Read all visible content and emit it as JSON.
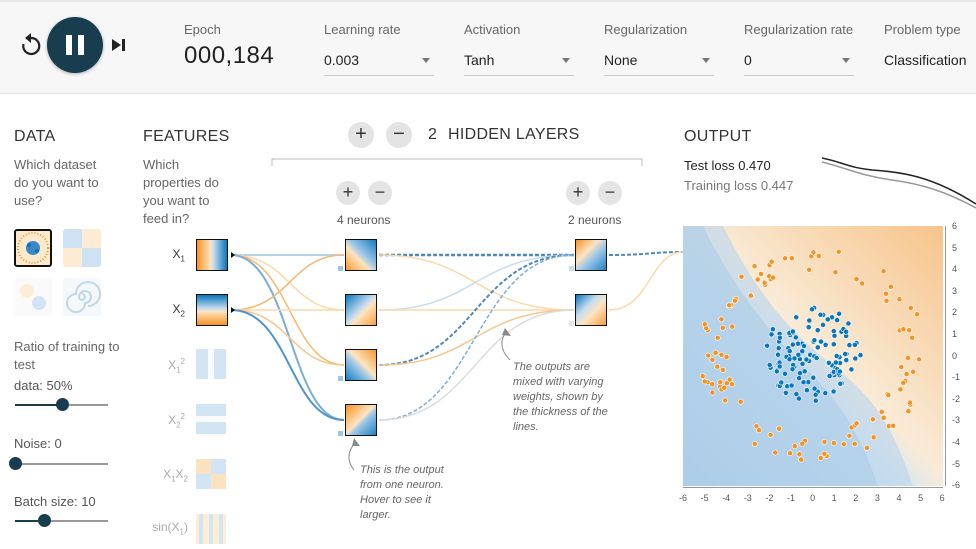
{
  "controls": {
    "epoch_label": "Epoch",
    "epoch_value": "000,184",
    "learning_rate_label": "Learning rate",
    "learning_rate_value": "0.003",
    "activation_label": "Activation",
    "activation_value": "Tanh",
    "regularization_label": "Regularization",
    "regularization_value": "None",
    "reg_rate_label": "Regularization rate",
    "reg_rate_value": "0",
    "problem_type_label": "Problem type",
    "problem_type_value": "Classification"
  },
  "data_panel": {
    "title": "DATA",
    "help": "Which dataset do you want to use?",
    "ratio_label": "Ratio of training to test",
    "ratio_value_label": "data:  50%",
    "ratio_value": 0.5,
    "noise_label": "Noise:  0",
    "noise_value": 0,
    "batch_label": "Batch size:  10",
    "batch_value": 0.3
  },
  "features_panel": {
    "title": "FEATURES",
    "help": "Which properties do you want to feed in?",
    "features": [
      "X1",
      "X2",
      "X1^2",
      "X2^2",
      "X1X2",
      "sin(X1)"
    ]
  },
  "hidden": {
    "count": "2",
    "title": "HIDDEN LAYERS",
    "layer1_neurons": "4 neurons",
    "layer2_neurons": "2 neurons",
    "plus": "+",
    "minus": "−"
  },
  "annotations": {
    "neuron_hint": "This is the output from one neuron. Hover to see it larger.",
    "weights_hint": "The outputs are mixed with varying weights, shown by the thickness of the lines."
  },
  "output": {
    "title": "OUTPUT",
    "test_loss_label": "Test loss",
    "test_loss": "0.470",
    "train_loss_label": "Training loss",
    "train_loss": "0.447",
    "x_ticks": [
      "-6",
      "-5",
      "-4",
      "-3",
      "-2",
      "-1",
      "0",
      "1",
      "2",
      "3",
      "4",
      "5",
      "6"
    ],
    "y_ticks": [
      "6",
      "5",
      "4",
      "3",
      "2",
      "1",
      "0",
      "-1",
      "-2",
      "-3",
      "-4",
      "-5",
      "-6"
    ]
  },
  "colors": {
    "blue": "#0877bd",
    "orange": "#f59322",
    "dark": "#183d4e"
  },
  "icons": [
    "reset-icon",
    "pause-icon",
    "step-icon"
  ]
}
